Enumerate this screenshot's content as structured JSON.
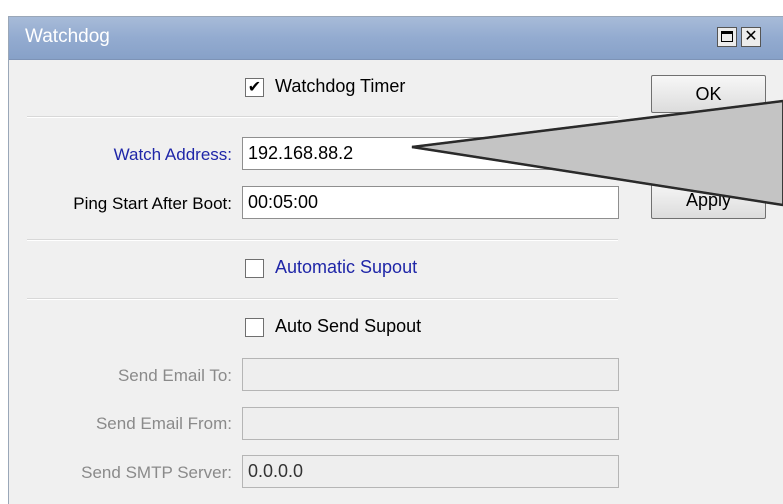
{
  "window": {
    "title": "Watchdog",
    "maximize_glyph": "",
    "close_glyph": "✕"
  },
  "watchdog_timer": {
    "label": "Watchdog Timer",
    "checked": true,
    "check_glyph": "✔"
  },
  "watch_address": {
    "label": "Watch Address:",
    "value": "192.168.88.2"
  },
  "ping_start": {
    "label": "Ping Start After Boot:",
    "value": "00:05:00"
  },
  "automatic_supout": {
    "label": "Automatic Supout",
    "checked": false,
    "check_glyph": ""
  },
  "auto_send_supout": {
    "label": "Auto Send Supout",
    "checked": false,
    "check_glyph": ""
  },
  "send_email_to": {
    "label": "Send Email To:",
    "value": ""
  },
  "send_email_from": {
    "label": "Send Email From:",
    "value": ""
  },
  "send_smtp_server": {
    "label": "Send SMTP Server:",
    "value": "0.0.0.0"
  },
  "buttons": {
    "ok": "OK",
    "cancel": "",
    "apply": "Apply"
  },
  "colors": {
    "titlebar": "#93abd0",
    "highlight_label": "#1f26a8",
    "callout_fill": "#c4c4c4"
  }
}
